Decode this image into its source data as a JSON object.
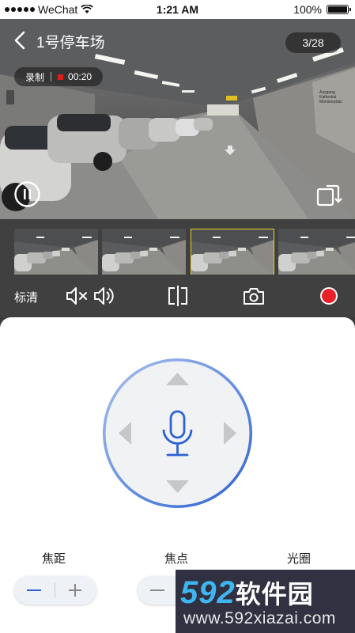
{
  "status_bar": {
    "carrier": "WeChat",
    "time": "1:21 AM",
    "battery": "100%",
    "battery_level": 1.0
  },
  "video": {
    "title": "1号停车场",
    "counter": "3/28",
    "record_label": "录制",
    "record_time": "00:20",
    "sign_text": [
      "Ausgang",
      "Kathedral",
      "Münsterplatz"
    ]
  },
  "thumbnails": {
    "count": 4,
    "selected_index": 2
  },
  "controls": {
    "quality_label": "标清",
    "icons": [
      "mute-icon",
      "volume-icon",
      "split-screen-icon",
      "camera-icon",
      "record-icon"
    ]
  },
  "ptz": {
    "icons": [
      "arrow-up-icon",
      "arrow-down-icon",
      "arrow-left-icon",
      "arrow-right-icon",
      "microphone-icon"
    ],
    "accent_color": "#2d63d1"
  },
  "adjusters": [
    {
      "label": "焦距"
    },
    {
      "label": "焦点"
    },
    {
      "label": "光圈"
    }
  ],
  "watermark": {
    "brand_number": "592",
    "brand_text": "软件园",
    "url": "www.592xiazai.com"
  }
}
